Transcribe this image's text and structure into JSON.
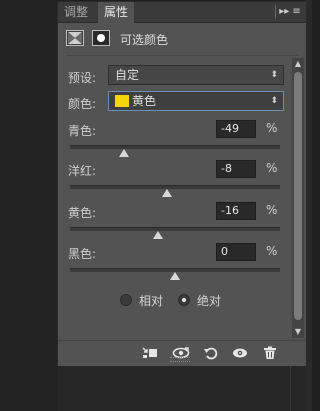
{
  "tabs": [
    {
      "label": "调整",
      "active": false
    },
    {
      "label": "属性",
      "active": true
    }
  ],
  "tab_menu_icon": "panel-menu-icon",
  "panel_header": {
    "title": "可选颜色",
    "icons": [
      "adjustment-layer-icon",
      "mask-icon"
    ]
  },
  "preset": {
    "label": "预设:",
    "value": "自定"
  },
  "colors": {
    "label": "颜色:",
    "value": "黄色",
    "swatch_color": "#f5d60d"
  },
  "sliders": [
    {
      "label": "青色:",
      "value": "-49",
      "unit": "%",
      "percent": -49
    },
    {
      "label": "洋红:",
      "value": "-8",
      "unit": "%",
      "percent": -8
    },
    {
      "label": "黄色:",
      "value": "-16",
      "unit": "%",
      "percent": -16
    },
    {
      "label": "黑色:",
      "value": "0",
      "unit": "%",
      "percent": 0
    }
  ],
  "method": {
    "options": [
      {
        "label": "相对",
        "checked": false
      },
      {
        "label": "绝对",
        "checked": true
      }
    ]
  },
  "footer_icons": [
    "clip-to-layer-icon",
    "view-previous-state-icon",
    "reset-icon",
    "visibility-eye-icon",
    "delete-trash-icon"
  ]
}
